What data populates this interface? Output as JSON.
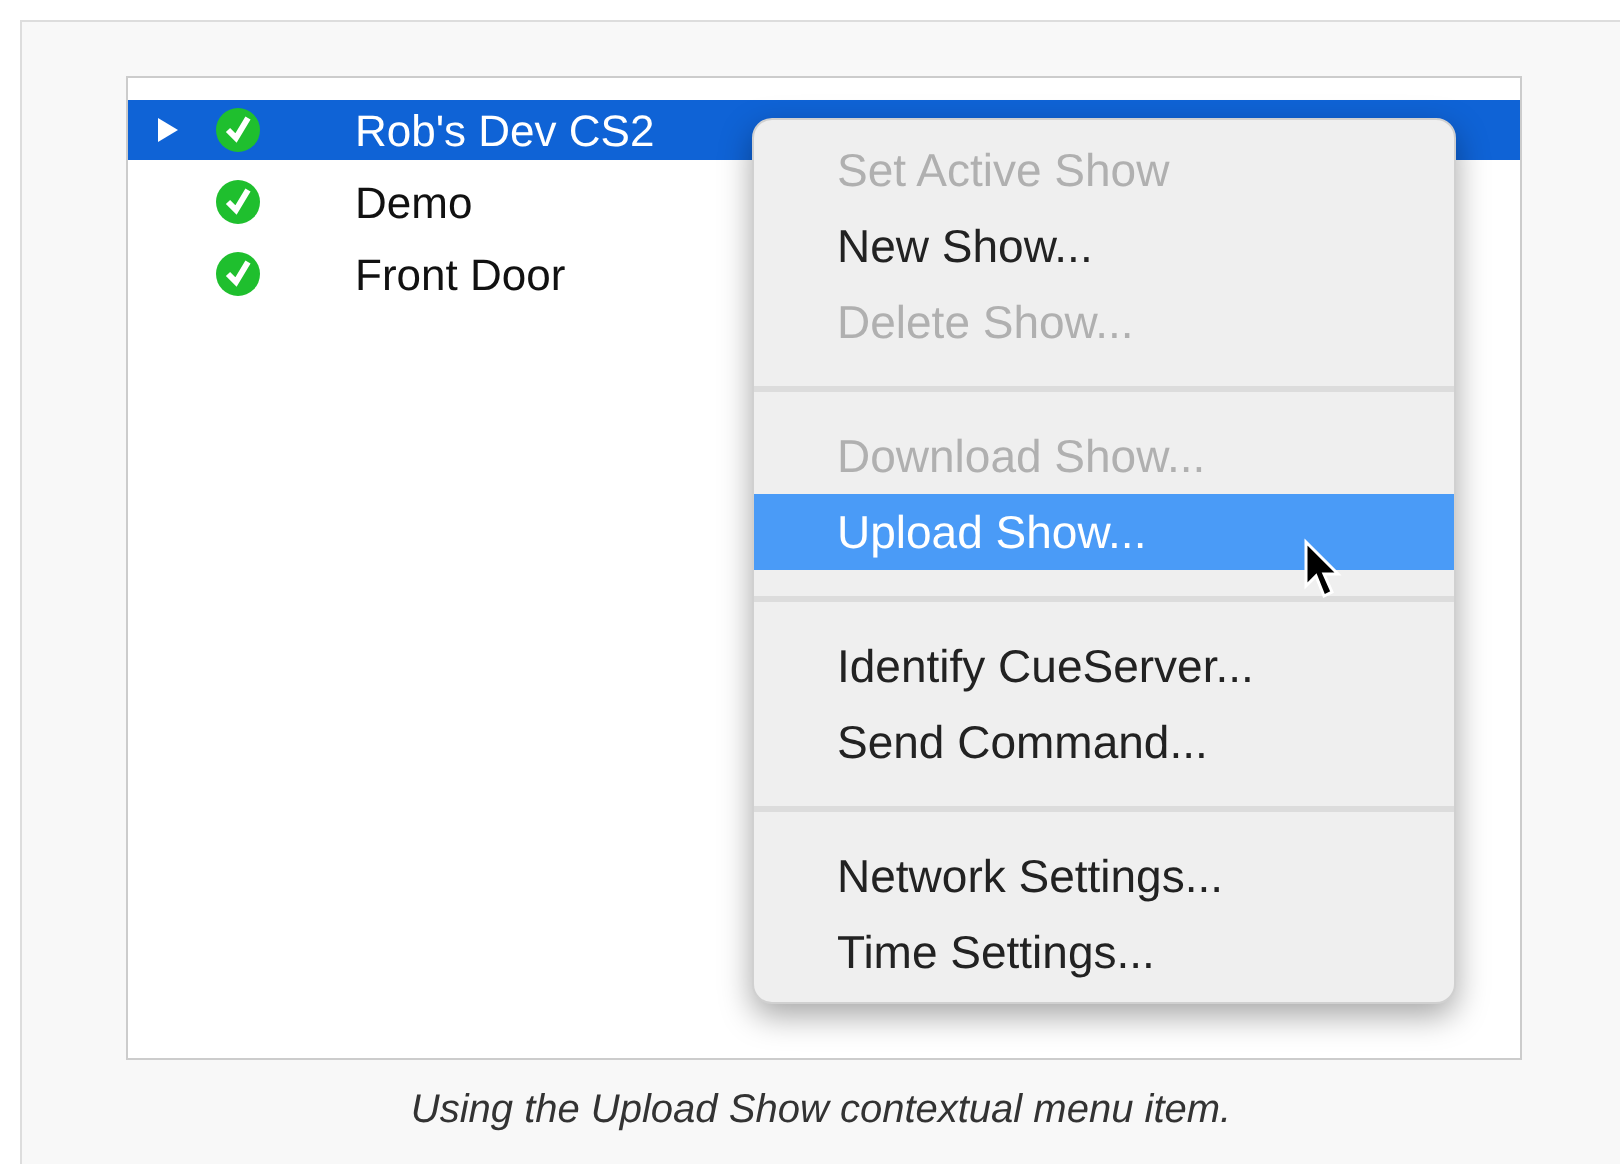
{
  "devices": [
    {
      "name": "Rob's Dev CS2",
      "has_children": true,
      "selected": true,
      "online": true
    },
    {
      "name": "Demo",
      "has_children": false,
      "selected": false,
      "online": true
    },
    {
      "name": "Front Door",
      "has_children": false,
      "selected": false,
      "online": true
    }
  ],
  "context_menu": [
    {
      "kind": "item",
      "label": "Set Active Show",
      "disabled": true,
      "selected": false
    },
    {
      "kind": "item",
      "label": "New Show...",
      "disabled": false,
      "selected": false
    },
    {
      "kind": "item",
      "label": "Delete Show...",
      "disabled": true,
      "selected": false
    },
    {
      "kind": "separator"
    },
    {
      "kind": "item",
      "label": "Download Show...",
      "disabled": true,
      "selected": false
    },
    {
      "kind": "item",
      "label": "Upload Show...",
      "disabled": false,
      "selected": true
    },
    {
      "kind": "separator"
    },
    {
      "kind": "item",
      "label": "Identify CueServer...",
      "disabled": false,
      "selected": false
    },
    {
      "kind": "item",
      "label": "Send Command...",
      "disabled": false,
      "selected": false
    },
    {
      "kind": "separator"
    },
    {
      "kind": "item",
      "label": "Network Settings...",
      "disabled": false,
      "selected": false
    },
    {
      "kind": "item",
      "label": "Time Settings...",
      "disabled": false,
      "selected": false
    }
  ],
  "caption": "Using the Upload Show contextual menu item."
}
